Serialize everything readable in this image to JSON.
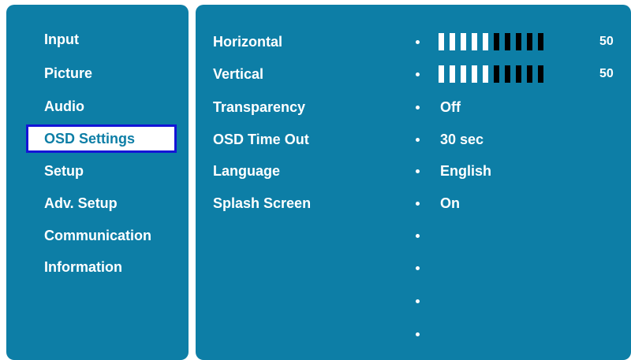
{
  "menu": {
    "items": [
      {
        "label": "Input"
      },
      {
        "label": "Picture"
      },
      {
        "label": "Audio"
      },
      {
        "label": "OSD Settings"
      },
      {
        "label": "Setup"
      },
      {
        "label": "Adv. Setup"
      },
      {
        "label": "Communication"
      },
      {
        "label": "Information"
      }
    ],
    "selected": "OSD Settings"
  },
  "settings": {
    "horizontal": {
      "label": "Horizontal",
      "value": "50",
      "level_percent": 50
    },
    "vertical": {
      "label": "Vertical",
      "value": "50",
      "level_percent": 50
    },
    "transparency": {
      "label": "Transparency",
      "value": "Off"
    },
    "osd_time_out": {
      "label": "OSD Time Out",
      "value": "30 sec"
    },
    "language": {
      "label": "Language",
      "value": "English"
    },
    "splash_screen": {
      "label": "Splash Screen",
      "value": "On"
    }
  },
  "colors": {
    "panel": "#0d7ea6",
    "selection_border": "#1414d6",
    "text": "#ffffff",
    "slider_on": "#ffffff",
    "slider_off": "#000000"
  }
}
